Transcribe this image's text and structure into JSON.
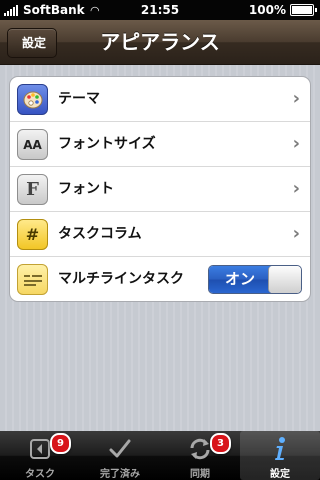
{
  "status": {
    "carrier": "SoftBank",
    "time": "21:55",
    "battery": "100%",
    "battery_level": 1.0
  },
  "nav": {
    "back_label": "設定",
    "title": "アピアランス"
  },
  "settings": [
    {
      "label": "テーマ",
      "icon": "palette-icon",
      "accessory": "chevron"
    },
    {
      "label": "フォントサイズ",
      "icon": "font-size-icon",
      "icon_text": "AA",
      "accessory": "chevron"
    },
    {
      "label": "フォント",
      "icon": "font-icon",
      "icon_text": "F",
      "accessory": "chevron"
    },
    {
      "label": "タスクコラム",
      "icon": "column-hash-icon",
      "icon_text": "#",
      "accessory": "chevron"
    },
    {
      "label": "マルチラインタスク",
      "icon": "multiline-icon",
      "accessory": "toggle",
      "toggle_label": "オン",
      "toggle_on": true
    }
  ],
  "tabs": [
    {
      "label": "タスク",
      "icon": "task-back-icon",
      "badge": "9",
      "active": false
    },
    {
      "label": "完了済み",
      "icon": "checkmark-icon",
      "active": false
    },
    {
      "label": "同期",
      "icon": "sync-icon",
      "badge": "3",
      "active": false
    },
    {
      "label": "設定",
      "icon": "info-icon",
      "active": true
    }
  ],
  "colors": {
    "nav": "#4a3c2f",
    "toggle_on": "#2a5fc1",
    "badge": "#d8141a"
  }
}
